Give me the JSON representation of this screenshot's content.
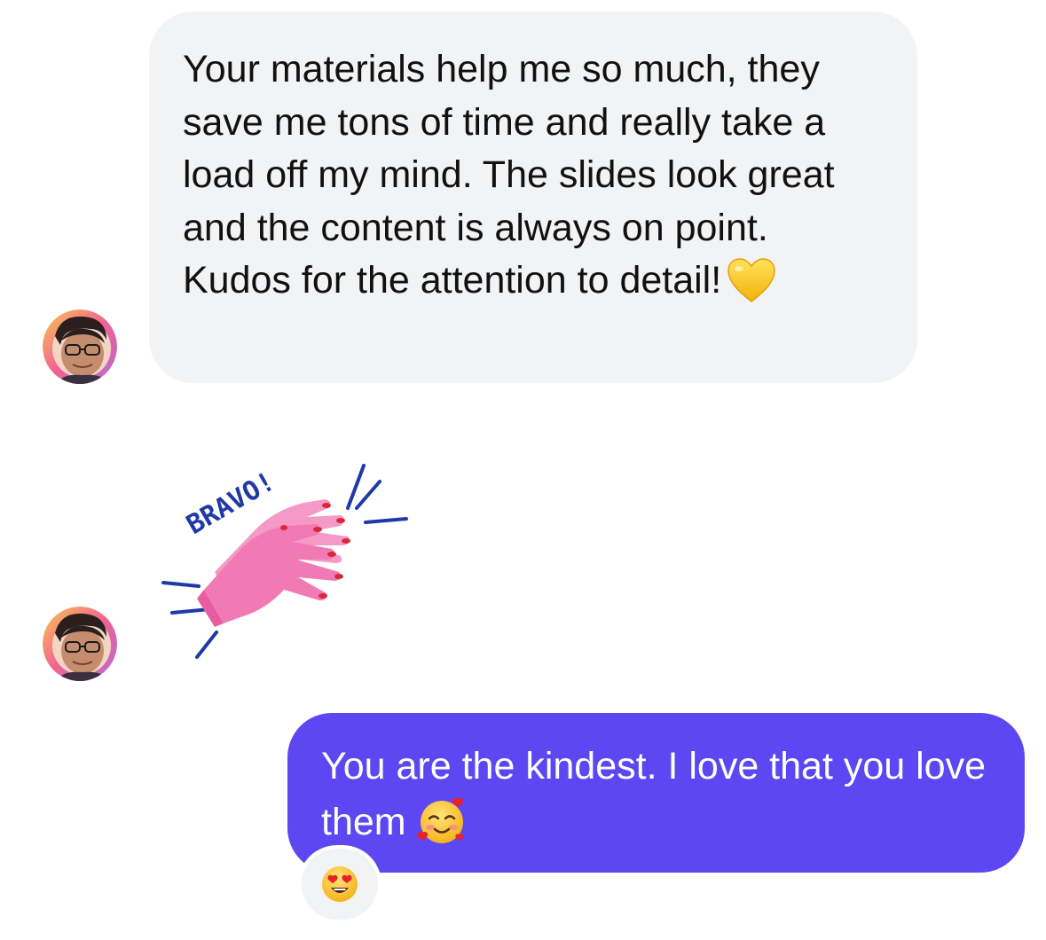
{
  "messages": {
    "incoming_text": "Your materials help me so much, they save me tons of time and really take a load off my mind. The slides look great and the content is always on point. Kudos for the attention to detail!",
    "incoming_emoji": "yellow-heart-emoji",
    "sticker_text": "BRAVO!",
    "sticker_icon": "clapping-hands-sticker",
    "outgoing_text": "You are the kindest. I love that you love them",
    "outgoing_emoji": "smiling-face-with-hearts-emoji",
    "reaction_emoji": "heart-eyes-emoji"
  },
  "colors": {
    "incoming_bubble": "#f2f3f5",
    "outgoing_bubble": "#5d47f3",
    "incoming_text": "#111111",
    "outgoing_text": "#ffffff"
  }
}
